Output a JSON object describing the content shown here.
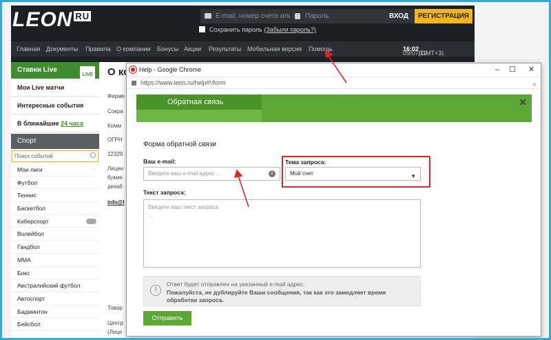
{
  "header": {
    "logo": "LEON",
    "logo_suffix": "RU",
    "email_placeholder": "E-mail, номер счета или т",
    "password_placeholder": "Пароль",
    "login_label": "ВХОД",
    "register_label": "РЕГИСТРАЦИЯ",
    "remember_label": "Сохранить пароль",
    "forgot_label": "(Забыли пароль?)"
  },
  "nav": {
    "items": [
      "Главная",
      "Документы",
      "Правила",
      "О компании",
      "Бонусы",
      "Акции",
      "Результаты",
      "Мобильная версия",
      "Помощь"
    ],
    "date": "09/07/19",
    "time": "16:02",
    "tz": "(GMT+3)"
  },
  "sidebar": {
    "live_title": "Ставки Live",
    "live_badge": "LIVE",
    "my_live": "Мои Live матчи",
    "interesting": "Интересные события",
    "upcoming_prefix": "В ближайшие",
    "upcoming_link": "24 часа",
    "sport_header": "Спорт",
    "search_placeholder": "Поиск событий",
    "items": [
      "Мои лиги",
      "Футбол",
      "Теннис",
      "Баскетбол",
      "Киберспорт",
      "Волейбол",
      "Гандбол",
      "ММА",
      "Бокс",
      "Австралийский футбол",
      "Автоспорт",
      "Бадминтон",
      "Бейсбол"
    ]
  },
  "bgpage": {
    "title": "О ко",
    "lines": [
      "Фирме",
      "Сокра",
      "Комм",
      "ОГРН",
      "12329",
      "Лицен",
      "букме",
      "декаб",
      "info@l",
      "Товар",
      "Центр",
      "(Лице"
    ]
  },
  "popup": {
    "window_title": "Help - Google Chrome",
    "url": "https://www.leon.ru/help#!/form",
    "tab_label": "Обратная связь",
    "form_title": "Форма обратной связи",
    "email_label": "Ваш e-mail:",
    "email_placeholder": "Введите ваш e-mail адрес ...",
    "topic_label": "Тема запроса:",
    "topic_value": "Мой счет",
    "text_label": "Текст запроса:",
    "text_placeholder_1": "Введите ваш текст запроса",
    "text_placeholder_2": "...",
    "note_line1": "Ответ будет отправлен на указанный e-mail адрес.",
    "note_line2": "Пожалуйста, не дублируйте Ваши сообщения, так как это замедляет время обработки запроса.",
    "send_label": "Отправить"
  },
  "colors": {
    "accent_green": "#5da737",
    "header_dark": "#1c1f24",
    "register_yellow": "#f6b519",
    "highlight_red": "#e0252b",
    "frame_blue": "#33aad8"
  }
}
